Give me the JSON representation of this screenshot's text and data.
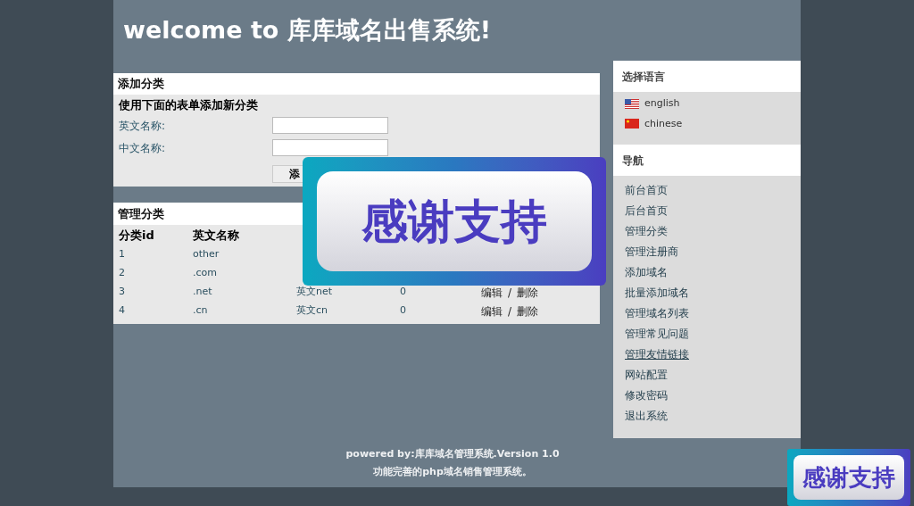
{
  "header": {
    "title": "welcome to 库库域名出售系统!"
  },
  "add_form": {
    "title": "添加分类",
    "subtitle": "使用下面的表单添加新分类",
    "fields": [
      {
        "label": "英文名称:"
      },
      {
        "label": "中文名称:"
      }
    ],
    "submit": "添"
  },
  "manage": {
    "title": "管理分类",
    "columns": [
      "分类id",
      "英文名称"
    ],
    "rows": [
      {
        "cells": [
          "1",
          "other"
        ]
      },
      {
        "cells": [
          "2",
          ".com"
        ]
      },
      {
        "cells": [
          "3",
          ".net",
          "英文net",
          "0"
        ],
        "actions": [
          "编辑",
          "/",
          "删除"
        ]
      },
      {
        "cells": [
          "4",
          ".cn",
          "英文cn",
          "0"
        ],
        "actions": [
          "编辑",
          "/",
          "删除"
        ]
      }
    ]
  },
  "sidebar": {
    "language_title": "选择语言",
    "languages": [
      {
        "label": "english",
        "kind": "us"
      },
      {
        "label": "chinese",
        "kind": "cn"
      }
    ],
    "nav_title": "导航",
    "nav_items": [
      {
        "label": "前台首页",
        "hovered": false
      },
      {
        "label": "后台首页",
        "hovered": false
      },
      {
        "label": "管理分类",
        "hovered": false
      },
      {
        "label": "管理注册商",
        "hovered": false
      },
      {
        "label": "添加域名",
        "hovered": false
      },
      {
        "label": "批量添加域名",
        "hovered": false
      },
      {
        "label": "管理域名列表",
        "hovered": false
      },
      {
        "label": "管理常见问题",
        "hovered": false
      },
      {
        "label": "管理友情链接",
        "hovered": true
      },
      {
        "label": "网站配置",
        "hovered": false
      },
      {
        "label": "修改密码",
        "hovered": false
      },
      {
        "label": "退出系统",
        "hovered": false
      }
    ]
  },
  "footer": {
    "line1": "powered by:库库域名管理系统.Version 1.0",
    "line2": "功能完善的php域名销售管理系统。"
  },
  "popup": {
    "text": "感谢支持"
  },
  "corner_popup": {
    "text": "感谢支持"
  }
}
